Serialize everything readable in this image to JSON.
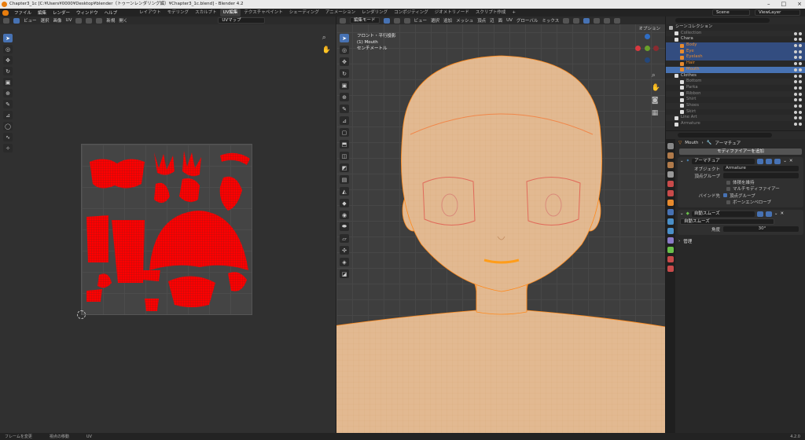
{
  "window": {
    "title": "Chapter3_1c [C:¥Users¥0000¥Desktop¥blender（トゥーンレンダリング編）¥Chapter3_1c.blend] - Blender 4.2"
  },
  "menubar": {
    "items": [
      "ファイル",
      "編集",
      "レンダー",
      "ウィンドウ",
      "ヘルプ"
    ],
    "workspaces": [
      "レイアウト",
      "モデリング",
      "スカルプト",
      "UV編集",
      "テクスチャペイント",
      "シェーディング",
      "アニメーション",
      "レンダリング",
      "コンポジティング",
      "ジオメトリノード",
      "スクリプト作成",
      "+"
    ],
    "active_workspace": "UV編集",
    "scene_label": "Scene",
    "viewlayer_label": "ViewLayer"
  },
  "uv_editor": {
    "menu": [
      "ビュー",
      "選択",
      "画像",
      "UV"
    ],
    "new_label": "新規",
    "open_label": "開く",
    "uvmap_label": "UVマップ"
  },
  "viewport": {
    "mode_label": "編集モード",
    "menu": [
      "ビュー",
      "選択",
      "追加",
      "メッシュ",
      "頂点",
      "辺",
      "面",
      "UV"
    ],
    "orientation": "グローバル",
    "pivot": "ミックス",
    "view_name": "フロント・平行投影",
    "object_info": "(1) Mouth",
    "unit_info": "センチメートル",
    "options_label": "オプション"
  },
  "outliner": {
    "rows": [
      {
        "label": "シーンコレクション",
        "indent": 0,
        "state": "normal"
      },
      {
        "label": "Collection",
        "indent": 1,
        "state": "normal",
        "muted": true
      },
      {
        "label": "Chara",
        "indent": 1,
        "state": "normal"
      },
      {
        "label": "Body",
        "indent": 2,
        "state": "sel",
        "orange": true
      },
      {
        "label": "Eye",
        "indent": 2,
        "state": "sel",
        "orange": true
      },
      {
        "label": "Eyelash",
        "indent": 2,
        "state": "sel",
        "orange": true
      },
      {
        "label": "Hair",
        "indent": 2,
        "state": "normal",
        "orange": true
      },
      {
        "label": "Mouth",
        "indent": 2,
        "state": "active",
        "orange": true
      },
      {
        "label": "Clothes",
        "indent": 1,
        "state": "normal"
      },
      {
        "label": "Bottom",
        "indent": 2,
        "state": "normal",
        "muted": true
      },
      {
        "label": "Parka",
        "indent": 2,
        "state": "normal",
        "muted": true
      },
      {
        "label": "Ribbon",
        "indent": 2,
        "state": "normal",
        "muted": true
      },
      {
        "label": "Shirt",
        "indent": 2,
        "state": "normal",
        "muted": true
      },
      {
        "label": "Shoes",
        "indent": 2,
        "state": "normal",
        "muted": true
      },
      {
        "label": "Skirt",
        "indent": 2,
        "state": "normal",
        "muted": true
      },
      {
        "label": "Line Art",
        "indent": 1,
        "state": "normal",
        "muted": true
      },
      {
        "label": "Armature",
        "indent": 1,
        "state": "normal",
        "muted": true
      }
    ]
  },
  "properties": {
    "breadcrumb_object": "Mouth",
    "breadcrumb_modifier": "アーマチュア",
    "add_modifier": "モディファイアーを追加",
    "armature_panel": {
      "name": "アーマチュア",
      "object_label": "オブジェクト",
      "object_value": "Armature",
      "vgroup_label": "頂点グループ",
      "preserve_volume": "体積を維持",
      "multi_modifier": "マルチモディファイアー",
      "bind_label": "バインド先",
      "bind_vgroups": "頂点グループ",
      "bind_envelopes": "ボーンエンベロープ"
    },
    "smooth_panel": {
      "name": "自動スムーズ",
      "node_label": "自動スムーズ",
      "angle_label": "角度",
      "angle_value": "30°"
    },
    "manage_label": "管理"
  },
  "statusbar": {
    "items": [
      "フレームを変更",
      "視点の移動",
      "UV"
    ],
    "version": "4.2.0"
  },
  "colors": {
    "accent": "#4772b3",
    "uv_island": "#ff0000",
    "skin": "#e2b991",
    "edit_wire": "#ff8a1c"
  }
}
